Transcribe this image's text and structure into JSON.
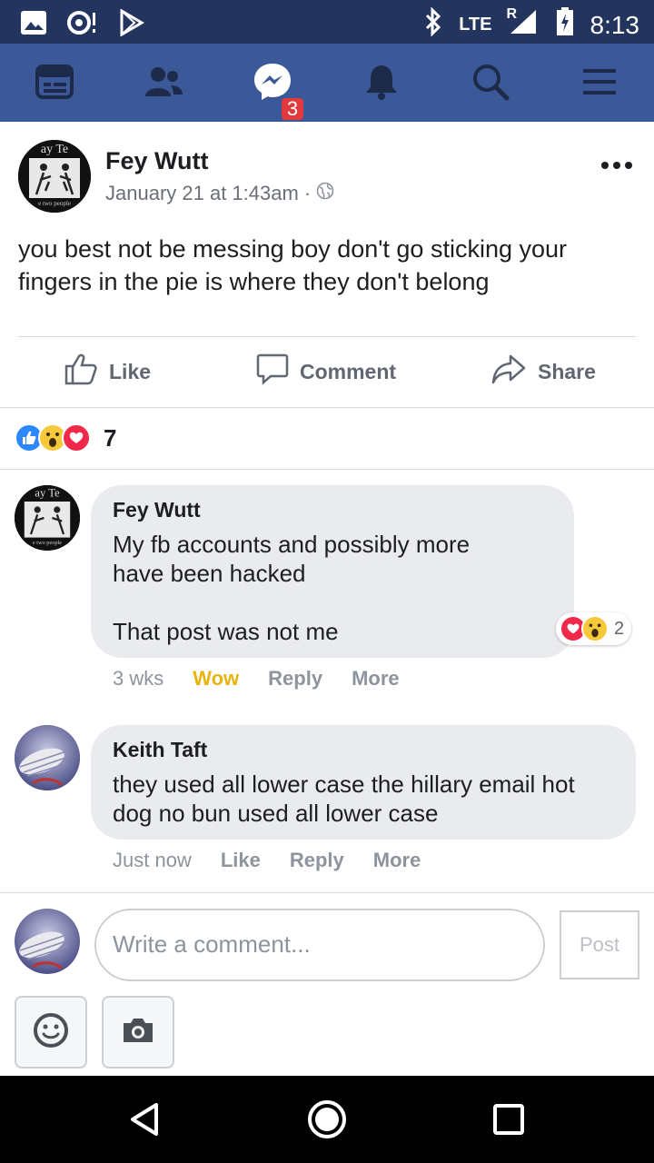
{
  "status_bar": {
    "network": "LTE",
    "roaming": "R",
    "time": "8:13",
    "icons": [
      "image-icon",
      "record-icon",
      "play-store-icon",
      "bluetooth-icon",
      "signal-icon",
      "battery-charging-icon"
    ]
  },
  "nav": {
    "icons": [
      "news-feed-icon",
      "friends-icon",
      "messenger-icon",
      "notifications-icon",
      "search-icon",
      "menu-icon"
    ],
    "messenger_badge": "3"
  },
  "post": {
    "author": "Fey Wutt",
    "timestamp": "January 21 at 1:43am",
    "separator": "·",
    "privacy_icon": "globe-icon",
    "text": "you best not be messing boy don't go sticking your fingers in the pie is where they don't belong",
    "avatar_text_top": "ay Te",
    "avatar_text_bottom": "e two people"
  },
  "actions": {
    "like": "Like",
    "comment": "Comment",
    "share": "Share"
  },
  "reactions": {
    "types": [
      "like",
      "wow",
      "love"
    ],
    "count": "7"
  },
  "comments": [
    {
      "author": "Fey Wutt",
      "text": "My fb accounts and possibly more\nhave been hacked\n\nThat post was not me",
      "time": "3 wks",
      "reaction_label": "Wow",
      "reply": "Reply",
      "more": "More",
      "reaction_count": "2"
    },
    {
      "author": "Keith Taft",
      "text": "they used all lower case the hillary email hot dog no bun used all lower case",
      "time": "Just now",
      "reaction_label": "Like",
      "reply": "Reply",
      "more": "More"
    }
  ],
  "composer": {
    "placeholder": "Write a comment...",
    "post_button": "Post"
  },
  "colors": {
    "status_bar": "#23345f",
    "nav_bar": "#3b5998",
    "badge": "#e0393e",
    "wow_text": "#e8b30b",
    "comment_bubble": "#eaebee"
  }
}
